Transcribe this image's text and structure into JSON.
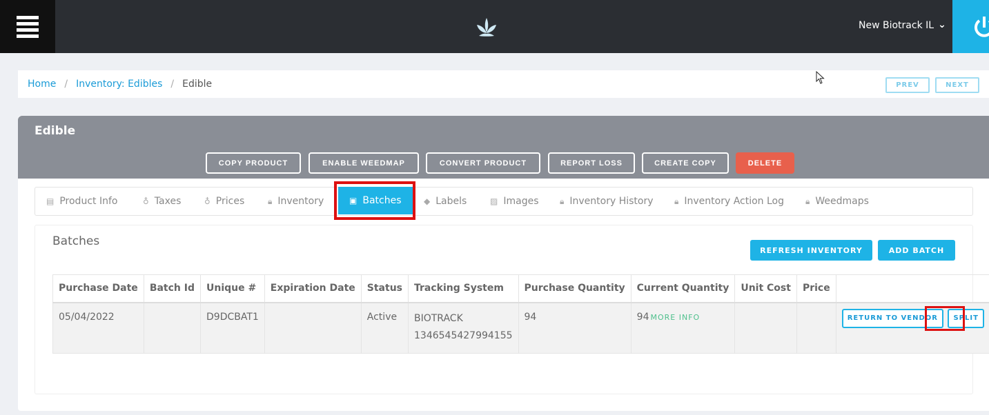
{
  "header": {
    "store_name": "New Biotrack IL",
    "menu_icon": "hamburger-icon",
    "logo_icon": "leaf-logo-icon",
    "power_icon": "power-icon"
  },
  "breadcrumb": {
    "home": "Home",
    "category": "Inventory: Edibles",
    "current": "Edible",
    "separator": "/"
  },
  "pager": {
    "prev": "PREV",
    "next": "NEXT"
  },
  "card": {
    "title": "Edible",
    "actions": {
      "copy_product": "COPY PRODUCT",
      "enable_weedmap": "ENABLE WEEDMAP",
      "convert_product": "CONVERT PRODUCT",
      "report_loss": "REPORT LOSS",
      "create_copy": "CREATE COPY",
      "delete": "DELETE"
    }
  },
  "tabs": [
    {
      "label": "Product Info",
      "icon": "store-icon"
    },
    {
      "label": "Taxes",
      "icon": "money-bag-icon"
    },
    {
      "label": "Prices",
      "icon": "money-bag-icon"
    },
    {
      "label": "Inventory",
      "icon": "lock-icon"
    },
    {
      "label": "Batches",
      "icon": "batch-icon",
      "active": true
    },
    {
      "label": "Labels",
      "icon": "tag-icon"
    },
    {
      "label": "Images",
      "icon": "image-icon"
    },
    {
      "label": "Inventory History",
      "icon": "lock-icon"
    },
    {
      "label": "Inventory Action Log",
      "icon": "lock-icon"
    },
    {
      "label": "Weedmaps",
      "icon": "lock-icon"
    }
  ],
  "batches": {
    "title": "Batches",
    "refresh_label": "REFRESH INVENTORY",
    "add_label": "ADD BATCH",
    "columns": [
      "Purchase Date",
      "Batch Id",
      "Unique #",
      "Expiration Date",
      "Status",
      "Tracking System",
      "Purchase Quantity",
      "Current Quantity",
      "Unit Cost",
      "Price",
      ""
    ],
    "rows": [
      {
        "purchase_date": "05/04/2022",
        "batch_id": "",
        "unique": "D9DCBAT1",
        "expiration_date": "",
        "status": "Active",
        "tracking_system": "BIOTRACK",
        "tracking_id": "1346545427994155",
        "purchase_quantity": "94",
        "current_quantity": "94",
        "more_info": "MORE INFO",
        "unit_cost": "",
        "price": "",
        "return_label": "RETURN TO VENDOR",
        "split_label": "SPLIT"
      }
    ]
  },
  "colors": {
    "accent": "#1eb3e6",
    "topbar": "#2b2e33",
    "card_header": "#8a8e96",
    "delete": "#e8604c",
    "highlight": "#dd1111"
  }
}
